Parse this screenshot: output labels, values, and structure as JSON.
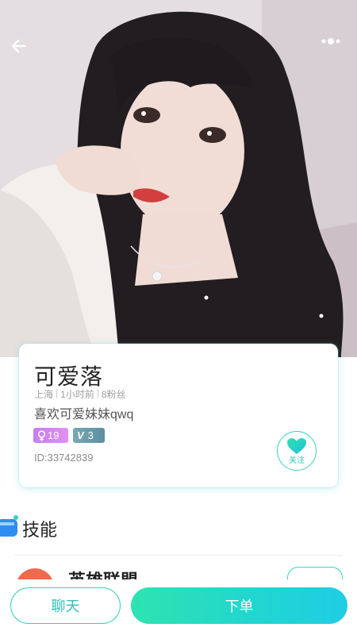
{
  "header": {
    "back_icon": "arrow-left-icon",
    "more_icon": "more-dots-icon"
  },
  "profile": {
    "name": "可爱落",
    "location": "上海",
    "last_active": "1小时前",
    "fans": "8粉丝",
    "bio": "喜欢可爱妹妹qwq",
    "age_badge": "19",
    "gender_icon": "female-icon",
    "level_badge_prefix": "V",
    "level_badge": "3",
    "user_id": "ID:33742839",
    "follow_label": "关注",
    "follow_icon": "heart-icon"
  },
  "skills": {
    "title": "技能",
    "items": [
      {
        "name": "英雄联盟",
        "tag": ""
      }
    ]
  },
  "actions": {
    "chat_label": "聊天",
    "order_label": "下单"
  },
  "colors": {
    "accent": "#38d1c0",
    "order_gradient_start": "#2ee3b0",
    "order_gradient_end": "#1fcde4",
    "female_badge": "#d988ef",
    "level_badge": "#6c9dab"
  }
}
